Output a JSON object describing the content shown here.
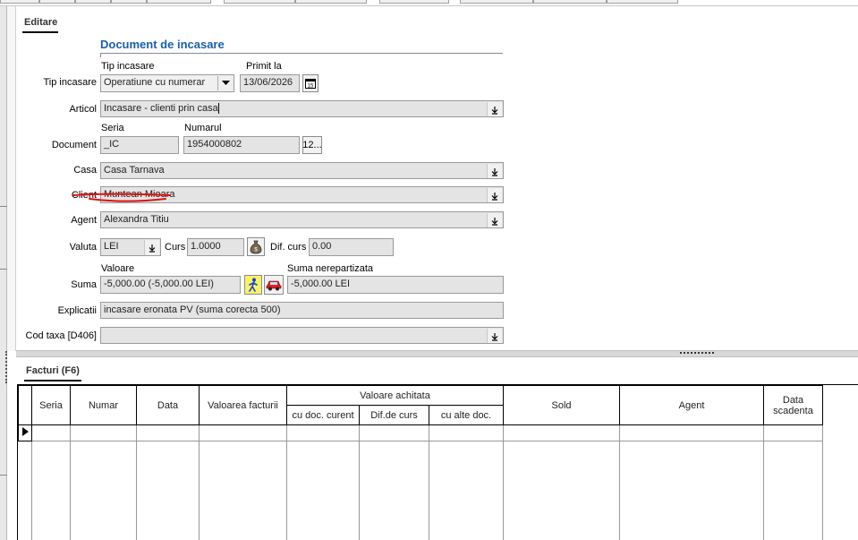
{
  "tabs": {
    "editare": "Editare",
    "facturi": "Facturi (F6)"
  },
  "form": {
    "title": "Document de incasare",
    "tip_incasare_caption": "Tip incasare",
    "primit_la_caption": "Primit la",
    "tip_incasare_label": "Tip incasare",
    "tip_incasare_value": "Operatiune cu numerar",
    "primit_la_value": "13/06/2026",
    "articol_label": "Articol",
    "articol_value": "Incasare - clienti prin casa",
    "seria_caption": "Seria",
    "numarul_caption": "Numarul",
    "document_label": "Document",
    "document_seria": "_IC",
    "document_numar": "1954000802",
    "document_btn": "12...",
    "casa_label": "Casa",
    "casa_value": "Casa Tarnava",
    "client_label": "Client",
    "client_value": "Muntean Mioara",
    "agent_label": "Agent",
    "agent_value": "Alexandra Titiu",
    "valuta_label": "Valuta",
    "valuta_value": "LEI",
    "curs_label": "Curs",
    "curs_value": "1.0000",
    "dif_curs_label": "Dif. curs",
    "dif_curs_value": "0.00",
    "valoare_caption": "Valoare",
    "suma_nerepartizata_caption": "Suma nerepartizata",
    "suma_label": "Suma",
    "suma_value": "-5,000.00 (-5,000.00 LEI)",
    "suma_nerepartizata_value": "-5,000.00 LEI",
    "explicatii_label": "Explicatii",
    "explicatii_value": "incasare eronata PV (suma corecta 500)",
    "cod_taxa_label": "Cod taxa [D406]",
    "cod_taxa_value": ""
  },
  "icons": {
    "calendar": "calendar-icon",
    "dropdown": "chevron-down-icon",
    "money_bag": "money-bag-icon",
    "walker": "walking-person-icon",
    "car": "car-icon"
  },
  "invoices_table": {
    "columns": {
      "seria": "Seria",
      "numar": "Numar",
      "data": "Data",
      "valoarea_facturii": "Valoarea facturii",
      "valoare_achitata": "Valoare achitata",
      "cu_doc_curent": "cu doc. curent",
      "dif_de_curs": "Dif.de curs",
      "cu_alte_doc": "cu alte doc.",
      "sold": "Sold",
      "agent": "Agent",
      "data_scadenta_1": "Data",
      "data_scadenta_2": "scadenta"
    },
    "rows": []
  },
  "colors": {
    "title_blue": "#1a5fa8",
    "field_bg": "#e4e4e4",
    "annotation_red": "#e01010"
  }
}
